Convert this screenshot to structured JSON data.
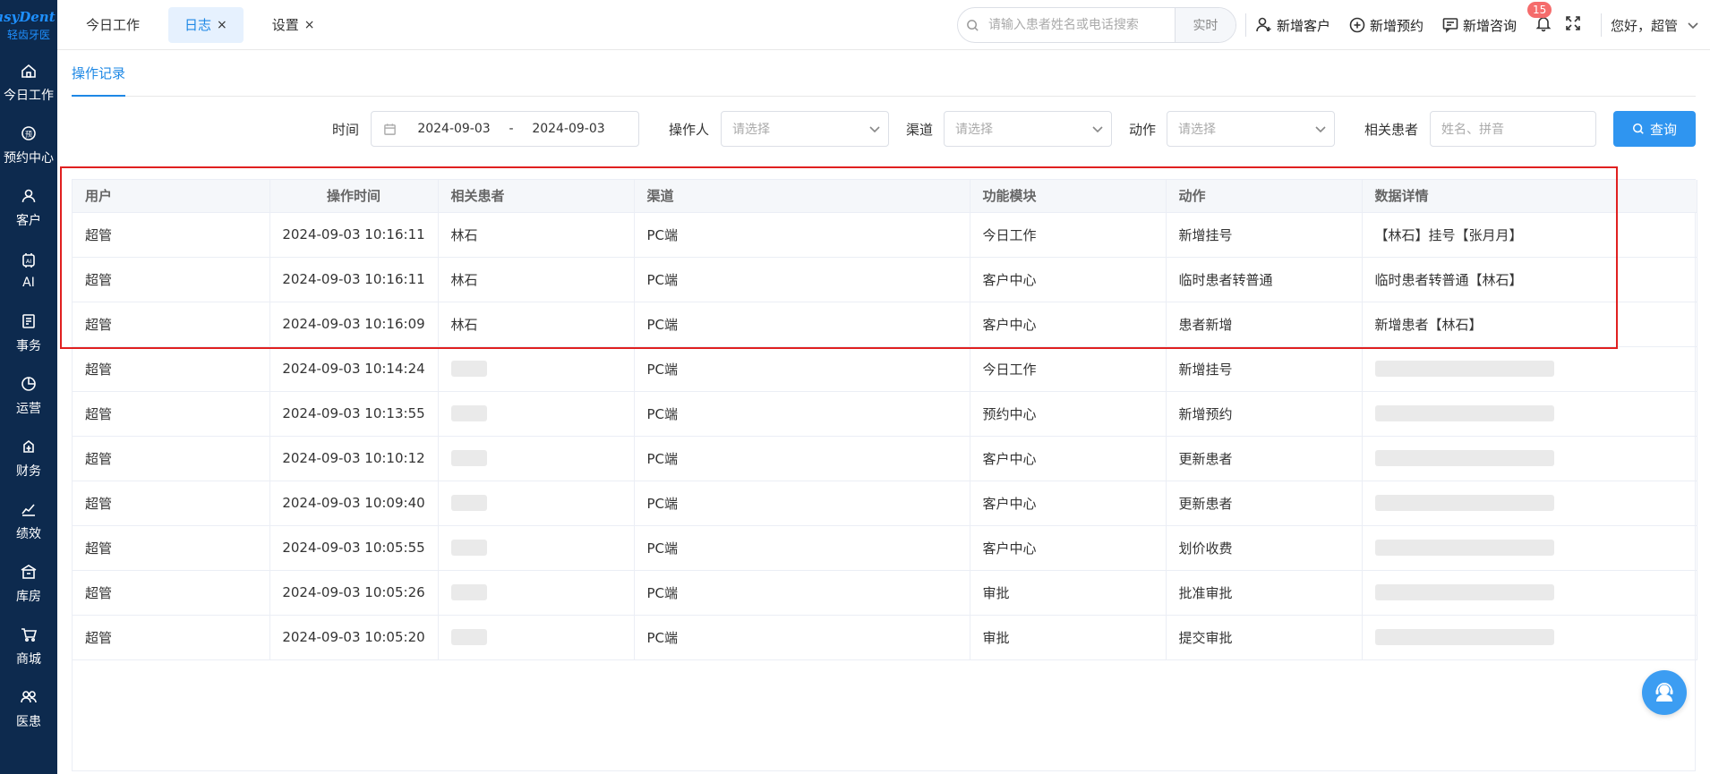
{
  "app": {
    "logo_text": "asyDent",
    "logo_sub": "轻齿牙医"
  },
  "sidebar": {
    "items": [
      {
        "label": "今日工作",
        "icon": "home-icon"
      },
      {
        "label": "预约中心",
        "icon": "appointment-icon"
      },
      {
        "label": "客户",
        "icon": "user-icon"
      },
      {
        "label": "AI",
        "icon": "ai-icon"
      },
      {
        "label": "事务",
        "icon": "document-icon"
      },
      {
        "label": "运营",
        "icon": "pie-chart-icon"
      },
      {
        "label": "财务",
        "icon": "finance-icon"
      },
      {
        "label": "绩效",
        "icon": "line-chart-icon"
      },
      {
        "label": "库房",
        "icon": "warehouse-icon"
      },
      {
        "label": "商城",
        "icon": "cart-icon"
      },
      {
        "label": "医患",
        "icon": "people-icon"
      }
    ]
  },
  "header": {
    "tabs": [
      {
        "label": "今日工作",
        "active": false,
        "closable": false
      },
      {
        "label": "日志",
        "active": true,
        "closable": true
      },
      {
        "label": "设置",
        "active": false,
        "closable": true
      }
    ],
    "close_glyph": "×",
    "search_placeholder": "请输入患者姓名或电话搜索",
    "search_button": "实时",
    "add_customer": "新增客户",
    "add_appointment": "新增预约",
    "add_consult": "新增咨询",
    "notification_count": "15",
    "greeting": "您好，超管"
  },
  "subtab": {
    "label": "操作记录"
  },
  "filters": {
    "time_label": "时间",
    "date_start": "2024-09-03",
    "date_sep": "-",
    "date_end": "2024-09-03",
    "operator_label": "操作人",
    "operator_placeholder": "请选择",
    "channel_label": "渠道",
    "channel_placeholder": "请选择",
    "action_label": "动作",
    "action_placeholder": "请选择",
    "patient_label": "相关患者",
    "patient_placeholder": "姓名、拼音",
    "query_button": "查询"
  },
  "table": {
    "columns": [
      "用户",
      "操作时间",
      "相关患者",
      "渠道",
      "功能模块",
      "动作",
      "数据详情"
    ],
    "rows": [
      {
        "user": "超管",
        "time": "2024-09-03 10:16:11",
        "patient": "林石",
        "channel": "PC端",
        "module": "今日工作",
        "action": "新增挂号",
        "detail": "【林石】挂号【张月月】"
      },
      {
        "user": "超管",
        "time": "2024-09-03 10:16:11",
        "patient": "林石",
        "channel": "PC端",
        "module": "客户中心",
        "action": "临时患者转普通",
        "detail": "临时患者转普通【林石】"
      },
      {
        "user": "超管",
        "time": "2024-09-03 10:16:09",
        "patient": "林石",
        "channel": "PC端",
        "module": "客户中心",
        "action": "患者新增",
        "detail": "新增患者【林石】"
      },
      {
        "user": "超管",
        "time": "2024-09-03 10:14:24",
        "patient": "",
        "channel": "PC端",
        "module": "今日工作",
        "action": "新增挂号",
        "detail": ""
      },
      {
        "user": "超管",
        "time": "2024-09-03 10:13:55",
        "patient": "",
        "channel": "PC端",
        "module": "预约中心",
        "action": "新增预约",
        "detail": ""
      },
      {
        "user": "超管",
        "time": "2024-09-03 10:10:12",
        "patient": "",
        "channel": "PC端",
        "module": "客户中心",
        "action": "更新患者",
        "detail": ""
      },
      {
        "user": "超管",
        "time": "2024-09-03 10:09:40",
        "patient": "",
        "channel": "PC端",
        "module": "客户中心",
        "action": "更新患者",
        "detail": ""
      },
      {
        "user": "超管",
        "time": "2024-09-03 10:05:55",
        "patient": "",
        "channel": "PC端",
        "module": "客户中心",
        "action": "划价收费",
        "detail": ""
      },
      {
        "user": "超管",
        "time": "2024-09-03 10:05:26",
        "patient": "",
        "channel": "PC端",
        "module": "审批",
        "action": "批准审批",
        "detail": ""
      },
      {
        "user": "超管",
        "time": "2024-09-03 10:05:20",
        "patient": "",
        "channel": "PC端",
        "module": "审批",
        "action": "提交审批",
        "detail": ""
      }
    ]
  },
  "colors": {
    "sidebar_bg": "#0d2a4e",
    "accent": "#1e88e5",
    "primary_button": "#2f95f0",
    "highlight_border": "#e02020",
    "badge": "#f56c6c"
  }
}
